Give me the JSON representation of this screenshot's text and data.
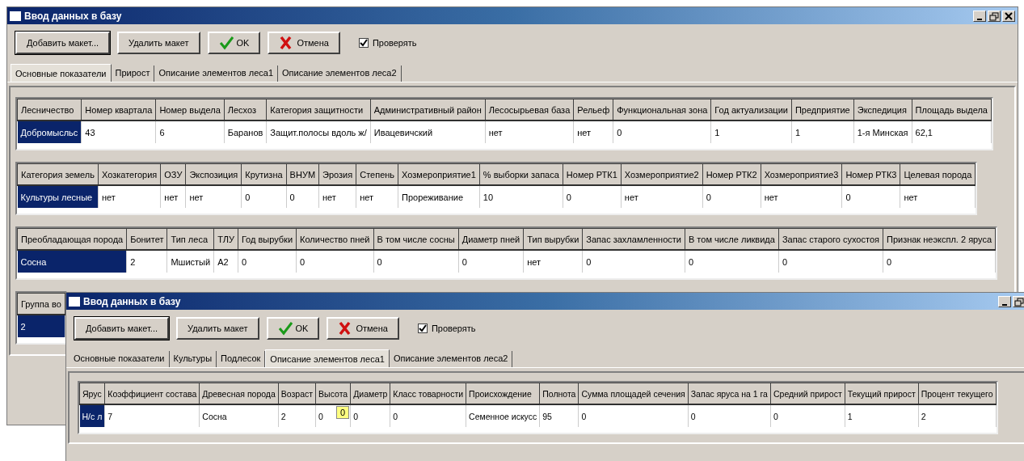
{
  "windows": [
    {
      "title": "Ввод данных в базу",
      "buttons": [
        {
          "label": "Добавить макет...",
          "kind": "add"
        },
        {
          "label": "Удалить макет",
          "kind": "delete"
        },
        {
          "label": "OK",
          "kind": "ok"
        },
        {
          "label": "Отмена",
          "kind": "cancel"
        }
      ],
      "checkbox": {
        "label": "Проверять",
        "checked": true
      },
      "tabs": [
        {
          "label": "Основные показатели",
          "selected": true
        },
        {
          "label": "Прирост",
          "selected": false
        },
        {
          "label": "Описание элементов леса1",
          "selected": false
        },
        {
          "label": "Описание элементов леса2",
          "selected": false
        }
      ],
      "grids": [
        {
          "columns": [
            "Лесничество",
            "Номер квартала",
            "Номер выдела",
            "Лесхоз",
            "Категория защитности",
            "Административный район",
            "Лесосырьевая база",
            "Рельеф",
            "Функциональная зона",
            "Год актуализации",
            "Предприятие",
            "Экспедиция",
            "Площадь выдела"
          ],
          "rows": [
            [
              {
                "text": "Добромысльс",
                "selected": true
              },
              {
                "text": "43",
                "selected": false
              },
              {
                "text": "6",
                "selected": false
              },
              {
                "text": "Баранов",
                "selected": false
              },
              {
                "text": "Защит.полосы вдоль ж/",
                "selected": false
              },
              {
                "text": "Ивацевичский",
                "selected": false
              },
              {
                "text": "нет",
                "selected": false
              },
              {
                "text": "нет",
                "selected": false
              },
              {
                "text": "0",
                "selected": false
              },
              {
                "text": "1",
                "selected": false
              },
              {
                "text": "1",
                "selected": false
              },
              {
                "text": "1-я Минская",
                "selected": false
              },
              {
                "text": "62,1",
                "selected": false
              }
            ]
          ]
        },
        {
          "columns": [
            "Категория земель",
            "Хозкатегория",
            "ОЗУ",
            "Экспозиция",
            "Крутизна",
            "ВНУМ",
            "Эрозия",
            "Степень",
            "Хозмероприятие1",
            "% выборки запаса",
            "Номер РТК1",
            "Хозмероприятие2",
            "Номер РТК2",
            "Хозмероприятие3",
            "Номер РТК3",
            "Целевая порода"
          ],
          "rows": [
            [
              {
                "text": "Культуры лесные",
                "selected": true
              },
              {
                "text": "нет",
                "selected": false
              },
              {
                "text": "нет",
                "selected": false
              },
              {
                "text": "нет",
                "selected": false
              },
              {
                "text": "0",
                "selected": false
              },
              {
                "text": "0",
                "selected": false
              },
              {
                "text": "нет",
                "selected": false
              },
              {
                "text": "нет",
                "selected": false
              },
              {
                "text": "Прореживание",
                "selected": false
              },
              {
                "text": "10",
                "selected": false
              },
              {
                "text": "0",
                "selected": false
              },
              {
                "text": "нет",
                "selected": false
              },
              {
                "text": "0",
                "selected": false
              },
              {
                "text": "нет",
                "selected": false
              },
              {
                "text": "0",
                "selected": false
              },
              {
                "text": "нет",
                "selected": false
              }
            ]
          ]
        },
        {
          "columns": [
            "Преобладающая порода",
            "Бонитет",
            "Тип леса",
            "ТЛУ",
            "Год вырубки",
            "Количество пней",
            "В том числе сосны",
            "Диаметр пней",
            "Тип вырубки",
            "Запас захламленности",
            "В том числе ликвида",
            "Запас старого сухостоя",
            "Признак неэкспл. 2 яруса"
          ],
          "rows": [
            [
              {
                "text": "Сосна",
                "selected": true
              },
              {
                "text": "2",
                "selected": false
              },
              {
                "text": "Мшистый",
                "selected": false
              },
              {
                "text": "А2",
                "selected": false
              },
              {
                "text": "0",
                "selected": false
              },
              {
                "text": "0",
                "selected": false
              },
              {
                "text": "0",
                "selected": false
              },
              {
                "text": "0",
                "selected": false
              },
              {
                "text": "нет",
                "selected": false
              },
              {
                "text": "0",
                "selected": false
              },
              {
                "text": "0",
                "selected": false
              },
              {
                "text": "0",
                "selected": false
              },
              {
                "text": "0",
                "selected": false
              }
            ]
          ]
        },
        {
          "columns": [
            "Группа во"
          ],
          "rows": [
            [
              {
                "text": "2",
                "selected": true
              }
            ]
          ]
        }
      ]
    },
    {
      "title": "Ввод данных в базу",
      "buttons": [
        {
          "label": "Добавить макет...",
          "kind": "add"
        },
        {
          "label": "Удалить макет",
          "kind": "delete"
        },
        {
          "label": "OK",
          "kind": "ok"
        },
        {
          "label": "Отмена",
          "kind": "cancel"
        }
      ],
      "checkbox": {
        "label": "Проверять",
        "checked": true
      },
      "tabs": [
        {
          "label": "Основные показатели",
          "selected": false
        },
        {
          "label": "Культуры",
          "selected": false
        },
        {
          "label": "Подлесок",
          "selected": false
        },
        {
          "label": "Описание элементов леса1",
          "selected": true
        },
        {
          "label": "Описание элементов леса2",
          "selected": false
        }
      ],
      "grids": [
        {
          "columns": [
            "Ярус",
            "Коэффициент состава",
            "Древесная порода",
            "Возраст",
            "Высота",
            "Диаметр",
            "Класс товарности",
            "Происхождение",
            "Полнота",
            "Сумма площадей сечения",
            "Запас яруса на 1 га",
            "Средний прирост",
            "Текущий прирост",
            "Процент текущего"
          ],
          "rows": [
            [
              {
                "text": "Н/с л",
                "selected": true
              },
              {
                "text": "7",
                "selected": false
              },
              {
                "text": "Сосна",
                "selected": false
              },
              {
                "text": "2",
                "selected": false
              },
              {
                "text": "0",
                "selected": false
              },
              {
                "text": "0",
                "selected": false
              },
              {
                "text": "0",
                "selected": false
              },
              {
                "text": "Семенное искусс",
                "selected": false
              },
              {
                "text": "95",
                "selected": false
              },
              {
                "text": "0",
                "selected": false
              },
              {
                "text": "0",
                "selected": false
              },
              {
                "text": "0",
                "selected": false
              },
              {
                "text": "1",
                "selected": false
              },
              {
                "text": "2",
                "selected": false
              }
            ]
          ],
          "tooltip": {
            "text": "0"
          }
        }
      ]
    }
  ]
}
